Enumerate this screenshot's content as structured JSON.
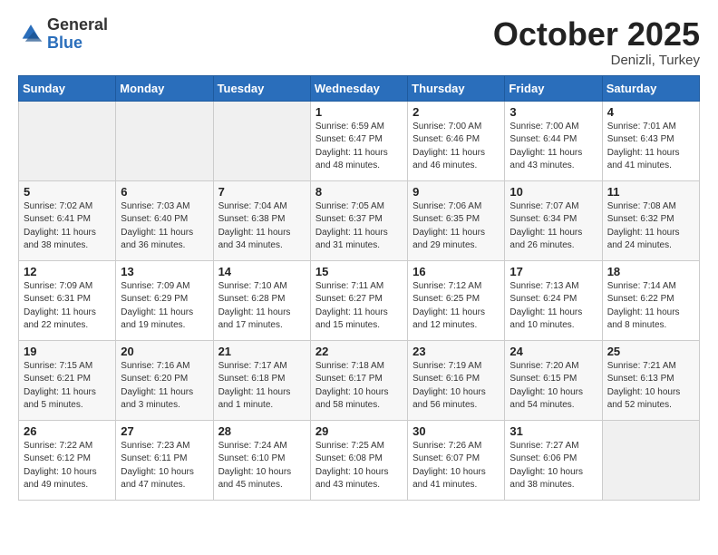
{
  "logo": {
    "general": "General",
    "blue": "Blue"
  },
  "title": "October 2025",
  "subtitle": "Denizli, Turkey",
  "days_header": [
    "Sunday",
    "Monday",
    "Tuesday",
    "Wednesday",
    "Thursday",
    "Friday",
    "Saturday"
  ],
  "weeks": [
    [
      {
        "day": "",
        "info": ""
      },
      {
        "day": "",
        "info": ""
      },
      {
        "day": "",
        "info": ""
      },
      {
        "day": "1",
        "info": "Sunrise: 6:59 AM\nSunset: 6:47 PM\nDaylight: 11 hours\nand 48 minutes."
      },
      {
        "day": "2",
        "info": "Sunrise: 7:00 AM\nSunset: 6:46 PM\nDaylight: 11 hours\nand 46 minutes."
      },
      {
        "day": "3",
        "info": "Sunrise: 7:00 AM\nSunset: 6:44 PM\nDaylight: 11 hours\nand 43 minutes."
      },
      {
        "day": "4",
        "info": "Sunrise: 7:01 AM\nSunset: 6:43 PM\nDaylight: 11 hours\nand 41 minutes."
      }
    ],
    [
      {
        "day": "5",
        "info": "Sunrise: 7:02 AM\nSunset: 6:41 PM\nDaylight: 11 hours\nand 38 minutes."
      },
      {
        "day": "6",
        "info": "Sunrise: 7:03 AM\nSunset: 6:40 PM\nDaylight: 11 hours\nand 36 minutes."
      },
      {
        "day": "7",
        "info": "Sunrise: 7:04 AM\nSunset: 6:38 PM\nDaylight: 11 hours\nand 34 minutes."
      },
      {
        "day": "8",
        "info": "Sunrise: 7:05 AM\nSunset: 6:37 PM\nDaylight: 11 hours\nand 31 minutes."
      },
      {
        "day": "9",
        "info": "Sunrise: 7:06 AM\nSunset: 6:35 PM\nDaylight: 11 hours\nand 29 minutes."
      },
      {
        "day": "10",
        "info": "Sunrise: 7:07 AM\nSunset: 6:34 PM\nDaylight: 11 hours\nand 26 minutes."
      },
      {
        "day": "11",
        "info": "Sunrise: 7:08 AM\nSunset: 6:32 PM\nDaylight: 11 hours\nand 24 minutes."
      }
    ],
    [
      {
        "day": "12",
        "info": "Sunrise: 7:09 AM\nSunset: 6:31 PM\nDaylight: 11 hours\nand 22 minutes."
      },
      {
        "day": "13",
        "info": "Sunrise: 7:09 AM\nSunset: 6:29 PM\nDaylight: 11 hours\nand 19 minutes."
      },
      {
        "day": "14",
        "info": "Sunrise: 7:10 AM\nSunset: 6:28 PM\nDaylight: 11 hours\nand 17 minutes."
      },
      {
        "day": "15",
        "info": "Sunrise: 7:11 AM\nSunset: 6:27 PM\nDaylight: 11 hours\nand 15 minutes."
      },
      {
        "day": "16",
        "info": "Sunrise: 7:12 AM\nSunset: 6:25 PM\nDaylight: 11 hours\nand 12 minutes."
      },
      {
        "day": "17",
        "info": "Sunrise: 7:13 AM\nSunset: 6:24 PM\nDaylight: 11 hours\nand 10 minutes."
      },
      {
        "day": "18",
        "info": "Sunrise: 7:14 AM\nSunset: 6:22 PM\nDaylight: 11 hours\nand 8 minutes."
      }
    ],
    [
      {
        "day": "19",
        "info": "Sunrise: 7:15 AM\nSunset: 6:21 PM\nDaylight: 11 hours\nand 5 minutes."
      },
      {
        "day": "20",
        "info": "Sunrise: 7:16 AM\nSunset: 6:20 PM\nDaylight: 11 hours\nand 3 minutes."
      },
      {
        "day": "21",
        "info": "Sunrise: 7:17 AM\nSunset: 6:18 PM\nDaylight: 11 hours\nand 1 minute."
      },
      {
        "day": "22",
        "info": "Sunrise: 7:18 AM\nSunset: 6:17 PM\nDaylight: 10 hours\nand 58 minutes."
      },
      {
        "day": "23",
        "info": "Sunrise: 7:19 AM\nSunset: 6:16 PM\nDaylight: 10 hours\nand 56 minutes."
      },
      {
        "day": "24",
        "info": "Sunrise: 7:20 AM\nSunset: 6:15 PM\nDaylight: 10 hours\nand 54 minutes."
      },
      {
        "day": "25",
        "info": "Sunrise: 7:21 AM\nSunset: 6:13 PM\nDaylight: 10 hours\nand 52 minutes."
      }
    ],
    [
      {
        "day": "26",
        "info": "Sunrise: 7:22 AM\nSunset: 6:12 PM\nDaylight: 10 hours\nand 49 minutes."
      },
      {
        "day": "27",
        "info": "Sunrise: 7:23 AM\nSunset: 6:11 PM\nDaylight: 10 hours\nand 47 minutes."
      },
      {
        "day": "28",
        "info": "Sunrise: 7:24 AM\nSunset: 6:10 PM\nDaylight: 10 hours\nand 45 minutes."
      },
      {
        "day": "29",
        "info": "Sunrise: 7:25 AM\nSunset: 6:08 PM\nDaylight: 10 hours\nand 43 minutes."
      },
      {
        "day": "30",
        "info": "Sunrise: 7:26 AM\nSunset: 6:07 PM\nDaylight: 10 hours\nand 41 minutes."
      },
      {
        "day": "31",
        "info": "Sunrise: 7:27 AM\nSunset: 6:06 PM\nDaylight: 10 hours\nand 38 minutes."
      },
      {
        "day": "",
        "info": ""
      }
    ]
  ]
}
